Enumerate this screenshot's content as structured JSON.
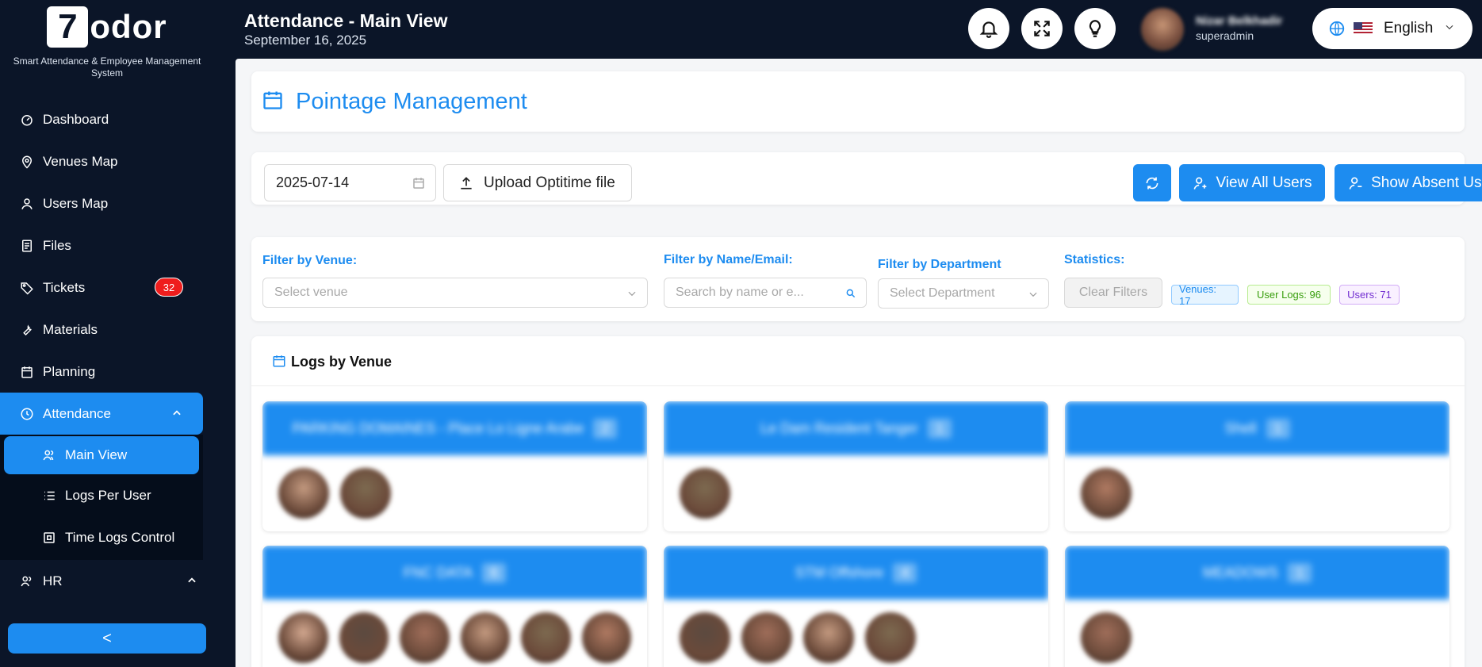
{
  "brand": {
    "logo_seven": "7",
    "logo_rest": "odor",
    "subtitle": "Smart Attendance & Employee Management System"
  },
  "sidebar": {
    "items": [
      {
        "label": "Dashboard",
        "icon": "dashboard-icon"
      },
      {
        "label": "Venues Map",
        "icon": "map-pin-icon"
      },
      {
        "label": "Users Map",
        "icon": "user-icon"
      },
      {
        "label": "Files",
        "icon": "file-icon"
      },
      {
        "label": "Tickets",
        "icon": "tag-icon",
        "badge": "32"
      },
      {
        "label": "Materials",
        "icon": "wrench-icon"
      },
      {
        "label": "Planning",
        "icon": "calendar-icon"
      }
    ],
    "attendance": {
      "label": "Attendance",
      "icon": "clock-icon",
      "subitems": [
        {
          "label": "Main View",
          "icon": "users-icon"
        },
        {
          "label": "Logs Per User",
          "icon": "list-icon"
        },
        {
          "label": "Time Logs Control",
          "icon": "grid-icon"
        }
      ]
    },
    "hr": {
      "label": "HR",
      "icon": "users-icon"
    },
    "collapse_label": "<"
  },
  "header": {
    "title": "Attendance - Main View",
    "date": "September 16, 2025",
    "user_name": "Nizar Belkhadir",
    "user_role": "superadmin",
    "language": "English"
  },
  "page": {
    "title": "Pointage Management",
    "date_value": "2025-07-14",
    "upload_label": "Upload Optitime file",
    "view_all_label": "View All Users",
    "show_absent_label": "Show Absent Users"
  },
  "filters": {
    "venue_label": "Filter by Venue:",
    "venue_placeholder": "Select venue",
    "name_label": "Filter by Name/Email:",
    "name_placeholder": "Search by name or e...",
    "dept_label": "Filter by Department",
    "dept_placeholder": "Select Department",
    "stats_label": "Statistics:",
    "clear_label": "Clear Filters",
    "stats": {
      "venues": "Venues: 17",
      "user_logs": "User Logs: 96",
      "users": "Users: 71"
    }
  },
  "logs": {
    "title": "Logs by Venue",
    "venues": [
      {
        "name": "PARKING DOMAINES - Place Lo Ligne Arabe",
        "count": "2",
        "faces": 2
      },
      {
        "name": "Le Dam Resident Tanger",
        "count": "1",
        "faces": 1
      },
      {
        "name": "Shell",
        "count": "1",
        "faces": 1
      },
      {
        "name": "FNC DATA",
        "count": "6",
        "faces": 6
      },
      {
        "name": "STM Offshore",
        "count": "4",
        "faces": 4
      },
      {
        "name": "MEADOWS",
        "count": "1",
        "faces": 1
      }
    ]
  },
  "colors": {
    "accent": "#1d8cf0",
    "sidebar_bg": "#0b1528",
    "badge_red": "#ef1d1d"
  }
}
